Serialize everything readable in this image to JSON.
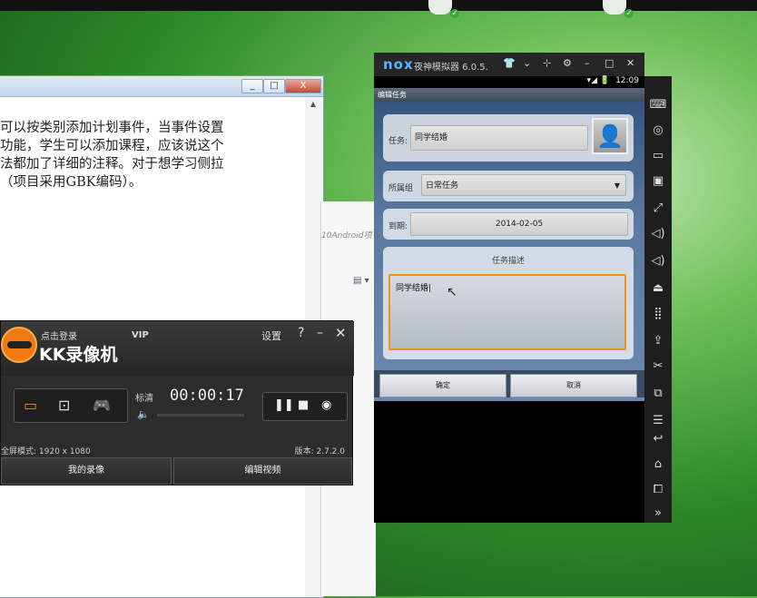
{
  "text_window": {
    "lines": [
      "可以按类别添加计划事件，当事件设置",
      "功能，学生可以添加课程，应该说这个",
      "法都加了详细的注释。对于想学习侧拉",
      "（项目采用GBK编码）。"
    ],
    "min_glyph": "_",
    "restore_glyph": "□",
    "close_glyph": "X"
  },
  "mid_window": {
    "path_text": "10Android项"
  },
  "nox": {
    "logo": "nox",
    "title": "夜神模拟器 6.0.5.",
    "controls": [
      "👕",
      "⌄",
      "⊹",
      "⚙",
      "–",
      "□",
      "✕"
    ],
    "status_time": "12:09",
    "status_icons": "▾◢ 🔋",
    "app_title": "编辑任务",
    "task_label": "任务:",
    "task_value": "同学结婚",
    "group_label": "所属组",
    "group_value": "日常任务",
    "due_label": "到期:",
    "due_value": "2014-02-05",
    "desc_label": "任务描述",
    "desc_value": "同学结婚",
    "ok_button": "确定",
    "cancel_button": "取消",
    "side_icons": [
      "⌨",
      "◎",
      "▭",
      "▣",
      "⤢",
      "◁)",
      "◁)",
      "⏏",
      "⣿",
      "⇪",
      "✂",
      "⧉",
      "☰",
      "↩",
      "⌂",
      "⧠",
      "»"
    ]
  },
  "kk": {
    "login": "点击登录",
    "brand": "KK录像机",
    "vip": "VIP",
    "settings": "设置",
    "help": "?",
    "minimize": "–",
    "close": "✕",
    "quality": "标清",
    "volume_icon": "🔈",
    "timer": "00:00:17",
    "pause": "❚❚",
    "stop": "■",
    "camera": "◉",
    "fullscreen_info": "全屏模式: 1920 x 1080",
    "version": "版本: 2.7.2.0",
    "my_recordings": "我的录像",
    "edit_video": "编辑视频"
  }
}
